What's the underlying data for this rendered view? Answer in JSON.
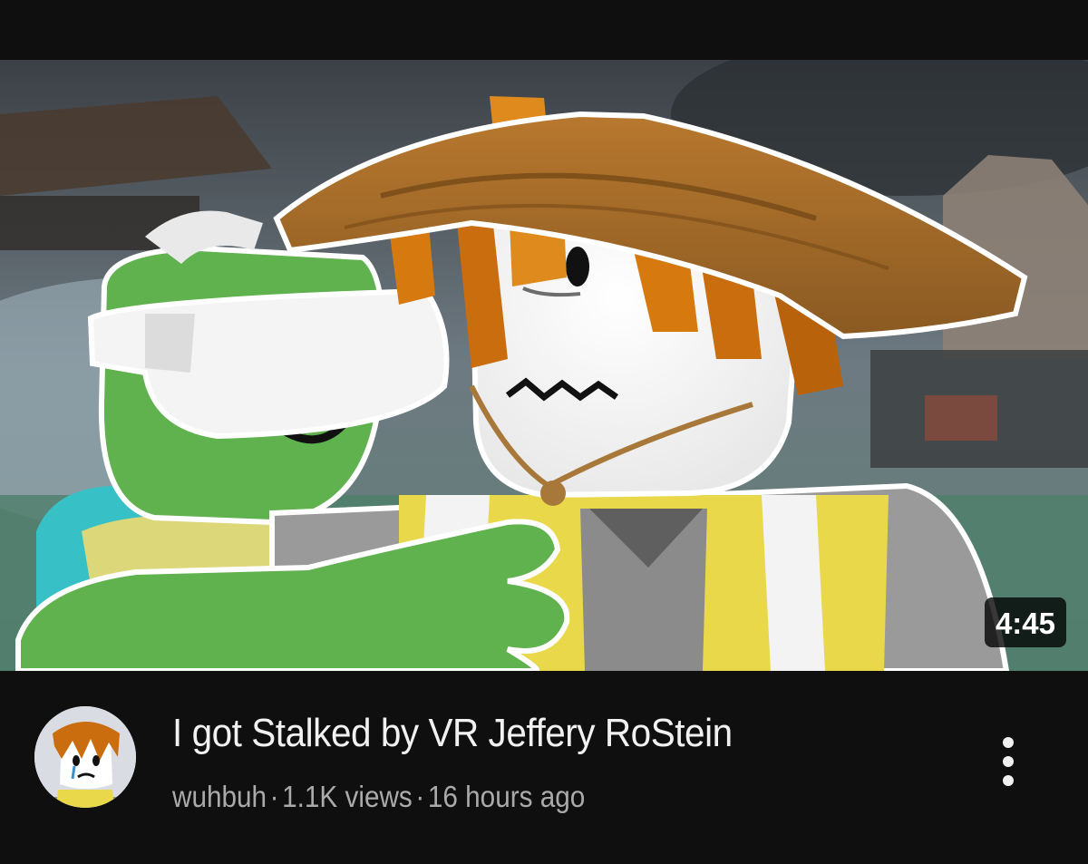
{
  "video": {
    "duration": "4:45",
    "title": "I got Stalked by VR Jeffery RoStein",
    "channel": "wuhbuh",
    "separator": "·",
    "views": "1.1K views",
    "age": "16 hours ago"
  },
  "icons": {
    "more": "more-vert-icon"
  }
}
